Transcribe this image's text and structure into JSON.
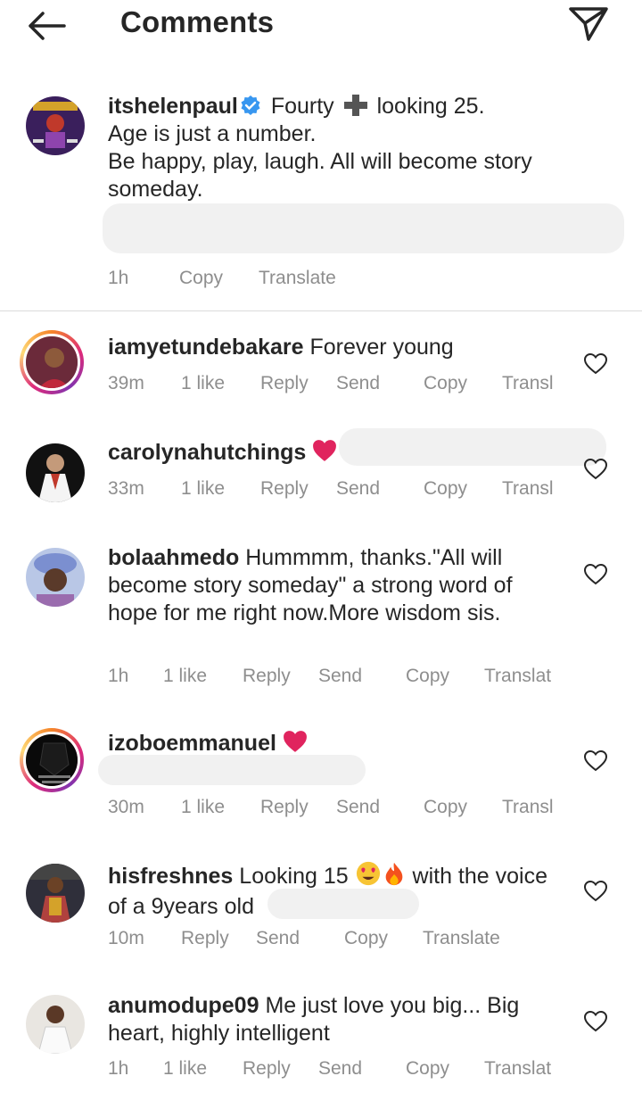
{
  "header": {
    "title": "Comments"
  },
  "caption": {
    "username": "itshelenpaul",
    "text": "Fourty",
    "text2": "looking 25.",
    "line2": "Age is just a number.",
    "line3": "Be happy, play, laugh. All will become story",
    "line4": "someday.",
    "time": "1h",
    "copy": "Copy",
    "translate": "Translate"
  },
  "comments": [
    {
      "username": "iamyetundebakare",
      "text": "Forever young",
      "time": "39m",
      "likes": "1 like",
      "reply": "Reply",
      "send": "Send",
      "copy": "Copy",
      "translate": "Transl"
    },
    {
      "username": "carolynahutchings",
      "text": "",
      "time": "33m",
      "likes": "1 like",
      "reply": "Reply",
      "send": "Send",
      "copy": "Copy",
      "translate": "Transl"
    },
    {
      "username": "bolaahmedo",
      "text": "Hummmm, thanks.\"All will",
      "text2": "become story someday\" a strong word of",
      "text3": "hope for me right now.More wisdom sis.",
      "time": "1h",
      "likes": "1 like",
      "reply": "Reply",
      "send": "Send",
      "copy": "Copy",
      "translate": "Translat"
    },
    {
      "username": "izoboemmanuel",
      "text": "",
      "time": "30m",
      "likes": "1 like",
      "reply": "Reply",
      "send": "Send",
      "copy": "Copy",
      "translate": "Transl"
    },
    {
      "username": "hisfreshnes",
      "text": "Looking 15",
      "text_after": "with the voice",
      "text2": "of a 9years old",
      "time": "10m",
      "reply": "Reply",
      "send": "Send",
      "copy": "Copy",
      "translate": "Translate"
    },
    {
      "username": "anumodupe09",
      "text": "Me just love you big... Big",
      "text2": "heart, highly intelligent",
      "time": "1h",
      "likes": "1 like",
      "reply": "Reply",
      "send": "Send",
      "copy": "Copy",
      "translate": "Translat"
    }
  ],
  "colors": {
    "text": "#262626",
    "meta": "#8e8e8e",
    "verified": "#3897f0",
    "heart_emoji": "#ed4956"
  }
}
